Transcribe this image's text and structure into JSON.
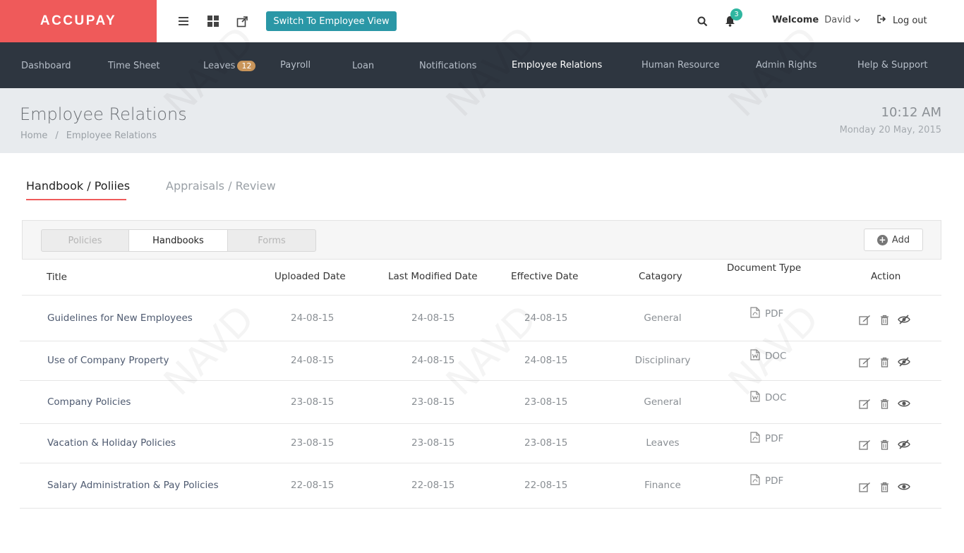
{
  "app": {
    "logo": "ACCUPAY",
    "switch_view_label": "Switch To Employee View",
    "notifications_count": "3",
    "welcome_label": "Welcome",
    "user_name": "David",
    "logout_label": "Log out"
  },
  "nav": {
    "items": [
      {
        "label": "Dashboard"
      },
      {
        "label": "Time Sheet"
      },
      {
        "label": "Leaves",
        "badge": "12"
      },
      {
        "label": "Payroll"
      },
      {
        "label": "Loan"
      },
      {
        "label": "Notifications"
      },
      {
        "label": "Employee Relations",
        "active": true
      },
      {
        "label": "Human Resource"
      },
      {
        "label": "Admin Rights"
      },
      {
        "label": "Help & Support"
      }
    ]
  },
  "header": {
    "title": "Employee Relations",
    "breadcrumb": [
      "Home",
      "Employee Relations"
    ],
    "time": "10:12 AM",
    "date": "Monday 20 May, 2015"
  },
  "tabs": [
    {
      "label": "Handbook / Poliies",
      "active": true
    },
    {
      "label": "Appraisals / Review",
      "active": false
    }
  ],
  "segments": [
    {
      "label": "Policies",
      "active": false
    },
    {
      "label": "Handbooks",
      "active": true
    },
    {
      "label": "Forms",
      "active": false
    }
  ],
  "add_label": "Add",
  "table": {
    "columns": [
      "Title",
      "Uploaded Date",
      "Last Modified Date",
      "Effective Date",
      "Catagory",
      "Document Type",
      "Action"
    ],
    "rows": [
      {
        "title": "Guidelines for New Employees",
        "uploaded": "24-08-15",
        "modified": "24-08-15",
        "effective": "24-08-15",
        "category": "General",
        "doctype": "PDF",
        "visible": false
      },
      {
        "title": "Use of Company Property",
        "uploaded": "24-08-15",
        "modified": "24-08-15",
        "effective": "24-08-15",
        "category": "Disciplinary",
        "doctype": "DOC",
        "visible": false
      },
      {
        "title": "Company Policies",
        "uploaded": "23-08-15",
        "modified": "23-08-15",
        "effective": "23-08-15",
        "category": "General",
        "doctype": "DOC",
        "visible": true
      },
      {
        "title": "Vacation & Holiday Policies",
        "uploaded": "23-08-15",
        "modified": "23-08-15",
        "effective": "23-08-15",
        "category": "Leaves",
        "doctype": "PDF",
        "visible": false
      },
      {
        "title": "Salary Administration & Pay Policies",
        "uploaded": "22-08-15",
        "modified": "22-08-15",
        "effective": "22-08-15",
        "category": "Finance",
        "doctype": "PDF",
        "visible": true
      }
    ]
  },
  "colors": {
    "brand": "#ef5a5a",
    "nav_bg": "#2e3640",
    "switch_btn": "#2a97a6",
    "badge": "#2fb6a0"
  }
}
